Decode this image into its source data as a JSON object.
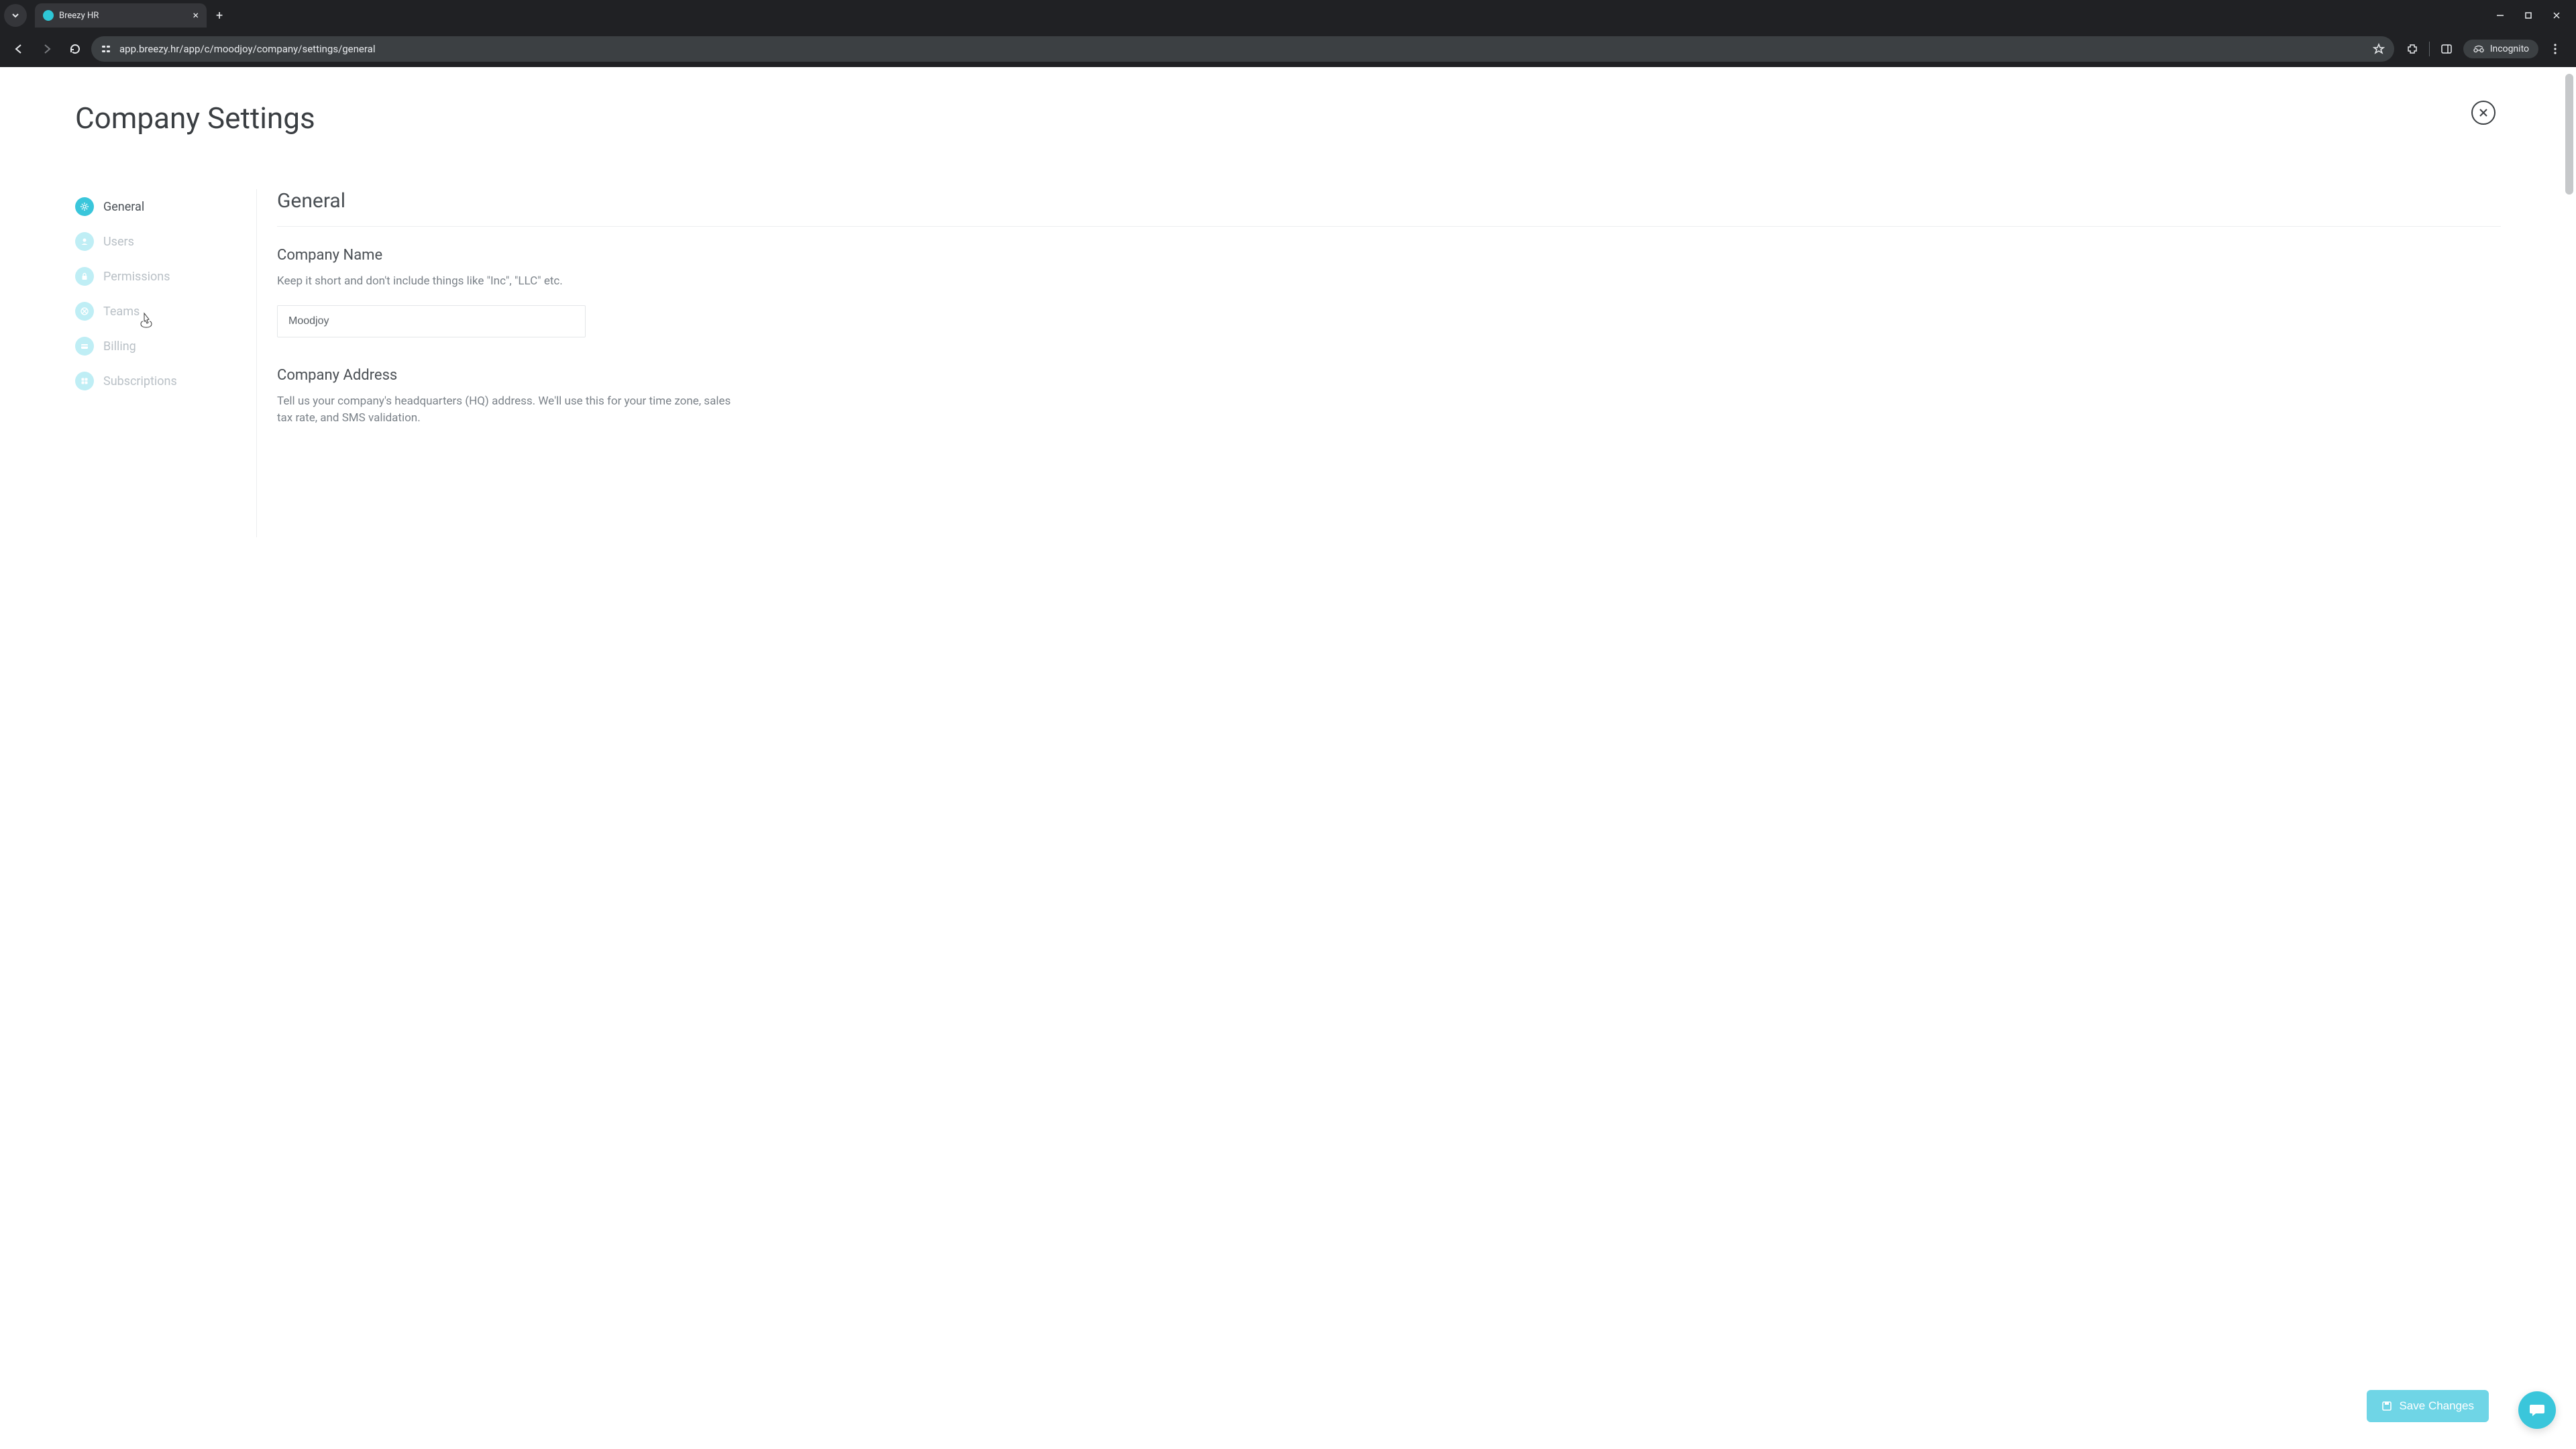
{
  "browser": {
    "tab_title": "Breezy HR",
    "url": "app.breezy.hr/app/c/moodjoy/company/settings/general",
    "incognito_label": "Incognito"
  },
  "header": {
    "title": "Company Settings"
  },
  "sidebar": {
    "items": [
      {
        "label": "General",
        "icon": "gear-icon",
        "active": true
      },
      {
        "label": "Users",
        "icon": "user-icon",
        "active": false
      },
      {
        "label": "Permissions",
        "icon": "lock-icon",
        "active": false
      },
      {
        "label": "Teams",
        "icon": "teams-icon",
        "active": false
      },
      {
        "label": "Billing",
        "icon": "card-icon",
        "active": false
      },
      {
        "label": "Subscriptions",
        "icon": "grid-icon",
        "active": false
      }
    ]
  },
  "main": {
    "section_title": "General",
    "company_name": {
      "label": "Company Name",
      "hint": "Keep it short and don't include things like \"Inc\", \"LLC\" etc.",
      "value": "Moodjoy"
    },
    "company_address": {
      "label": "Company Address",
      "hint": "Tell us your company's headquarters (HQ) address. We'll use this for your time zone, sales tax rate, and SMS validation."
    }
  },
  "actions": {
    "save_label": "Save Changes"
  }
}
